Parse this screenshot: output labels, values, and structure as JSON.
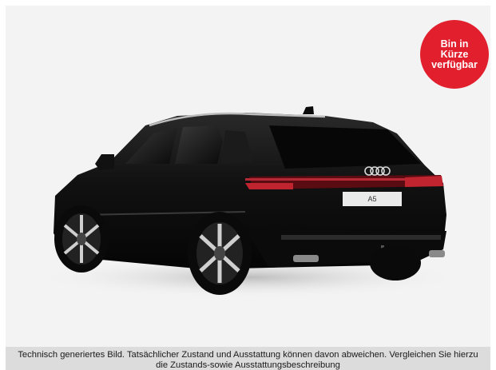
{
  "badge": {
    "line1": "Bin in",
    "line2": "Kürze",
    "line3": "verfügbar",
    "color": "#e21f2d"
  },
  "car": {
    "plate_text": "A5",
    "body_color": "#0d0d0d"
  },
  "disclaimer": {
    "line1": "Technisch generiertes Bild. Tatsächlicher Zustand und Ausstattung können davon abweichen. Vergleichen Sie hierzu",
    "line2": "die Zustands-sowie Ausstattungsbeschreibung"
  }
}
